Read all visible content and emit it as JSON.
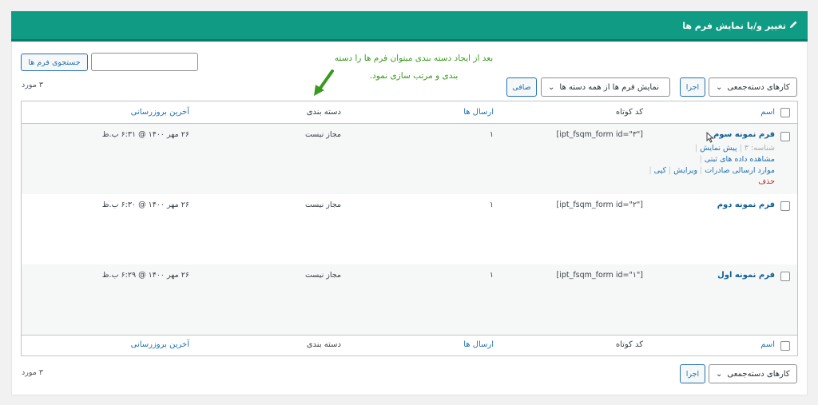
{
  "header": {
    "title": "تغییر و/یا نمایش فرم ها",
    "icon": "pencil-icon",
    "color": "#0f9b84"
  },
  "search": {
    "button_label": "جستجوی فرم ها",
    "value": ""
  },
  "annotation": {
    "line1": "بعد از ایجاد دسته بندی میتوان فرم ها را دسته",
    "line2": "بندی و مرتب سازی نمود.",
    "color": "#3a9a1f"
  },
  "top_nav": {
    "bulk_select": "کارهای دسته‌جمعی",
    "apply_label": "اجرا",
    "category_select": "نمایش فرم ها از همه دسته ها",
    "filter_label": "صافی",
    "count": "۳ مورد"
  },
  "bottom_nav": {
    "bulk_select": "کارهای دسته‌جمعی",
    "apply_label": "اجرا",
    "count": "۳ مورد"
  },
  "columns": {
    "name": "اسم",
    "shortcode": "کد کوتاه",
    "submissions": "ارسال ها",
    "category": "دسته بندی",
    "updated": "آخرین بروزرسانی"
  },
  "rows": [
    {
      "title": "فرم نمونه سوم",
      "shortcode": "[ipt_fsqm_form id=\"۳\"]",
      "submissions": "۱",
      "category": "مجاز نیست",
      "updated": "۲۶ مهر ۱۴۰۰ @ ۶:۳۱ ب.ظ",
      "actions": {
        "id_label": "شناسه: ۳",
        "preview": "پیش نمایش",
        "view_data": "مشاهده داده های ثبتی",
        "export": "موارد ارسالی صادرات",
        "edit": "ویرایش",
        "copy": "کپی",
        "delete": "حذف"
      }
    },
    {
      "title": "فرم نمونه دوم",
      "shortcode": "[ipt_fsqm_form id=\"۲\"]",
      "submissions": "۱",
      "category": "مجاز نیست",
      "updated": "۲۶ مهر ۱۴۰۰ @ ۶:۳۰ ب.ظ"
    },
    {
      "title": "فرم نمونه اول",
      "shortcode": "[ipt_fsqm_form id=\"۱\"]",
      "submissions": "۱",
      "category": "مجاز نیست",
      "updated": "۲۶ مهر ۱۴۰۰ @ ۶:۲۹ ب.ظ"
    }
  ]
}
